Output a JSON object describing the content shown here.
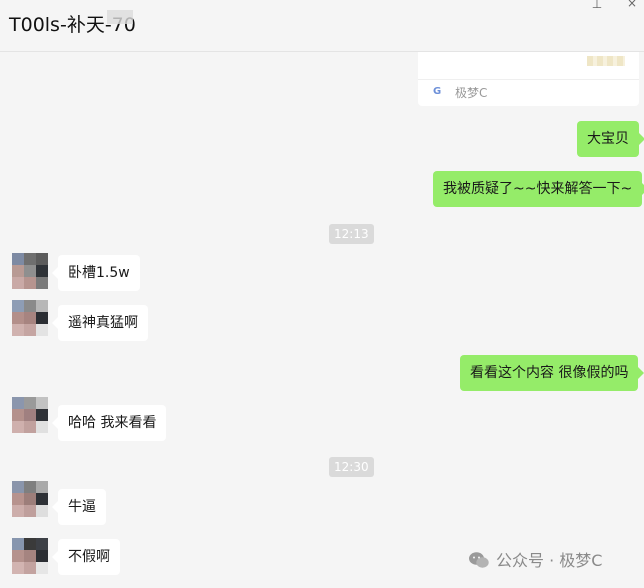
{
  "window": {
    "title": "T00ls-补天-70",
    "pin_glyph": "⊥",
    "close_glyph": "×"
  },
  "link_card": {
    "source_icon": "G",
    "source": "极梦C"
  },
  "messages": [
    {
      "side": "out",
      "text": "大宝贝"
    },
    {
      "side": "out",
      "text": "我被质疑了~~快来解答一下~"
    },
    {
      "type": "time",
      "text": "12:13"
    },
    {
      "side": "in",
      "text": "卧槽1.5w"
    },
    {
      "side": "in",
      "text": "遥神真猛啊"
    },
    {
      "side": "out",
      "text": "看看这个内容 很像假的吗"
    },
    {
      "side": "in",
      "text": "哈哈 我来看看"
    },
    {
      "type": "time",
      "text": "12:30"
    },
    {
      "side": "in",
      "text": "牛逼"
    },
    {
      "side": "in",
      "text": "不假啊"
    }
  ],
  "watermark": {
    "text": "公众号 · 极梦C"
  },
  "colors": {
    "outgoing_bubble": "#95ec69",
    "incoming_bubble": "#ffffff",
    "background": "#f5f5f5",
    "time_badge": "#dadada"
  }
}
